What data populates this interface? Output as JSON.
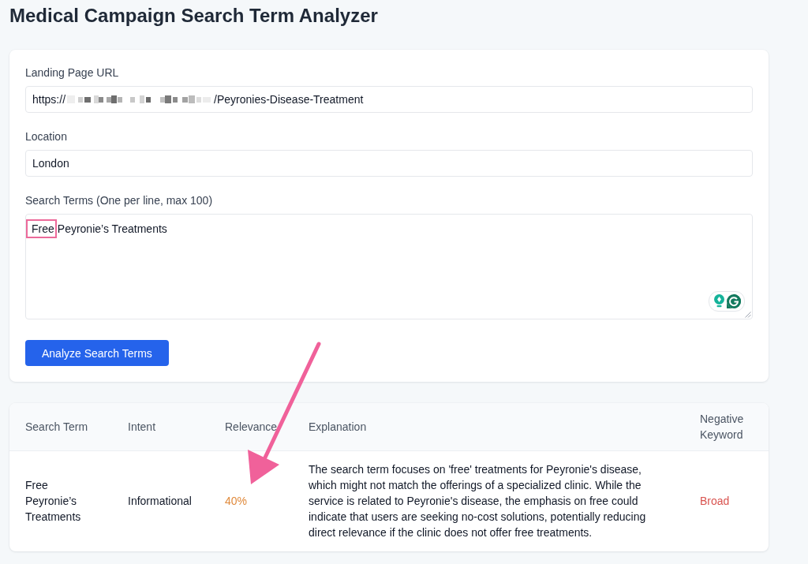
{
  "page": {
    "title": "Medical Campaign Search Term Analyzer"
  },
  "form": {
    "url": {
      "label": "Landing Page URL",
      "value_start": "https://",
      "redacted": true,
      "value_end": "/Peyronies-Disease-Treatment"
    },
    "location": {
      "label": "Location",
      "value": "London"
    },
    "search_terms": {
      "label": "Search Terms (One per line, max 100)",
      "value_parts": [
        {
          "text": "Free",
          "highlighted": true
        },
        {
          "text": "Peyronie’s Treatments",
          "highlighted": false
        }
      ],
      "assistant_widget": true
    },
    "button": "Analyze Search Terms"
  },
  "table": {
    "columns": [
      "Search Term",
      "Intent",
      "Relevance",
      "Explanation",
      "Negative Keyword"
    ],
    "rows": [
      {
        "search_term": "Free Peyronie’s Treatments",
        "intent": "Informational",
        "relevance": {
          "text": "40%",
          "color": "#e08a3c"
        },
        "explanation": "The search term focuses on 'free' treatments for Peyronie's disease, which might not match the offerings of a specialized clinic. While the service is related to Peyronie's disease, the emphasis on free could indicate that users are seeking no-cost solutions, potentially reducing direct relevance if the clinic does not offer free treatments.",
        "negative_keyword": {
          "text": "Broad",
          "color": "#d9534f"
        }
      }
    ]
  },
  "annotations": [
    {
      "kind": "arrow"
    }
  ]
}
